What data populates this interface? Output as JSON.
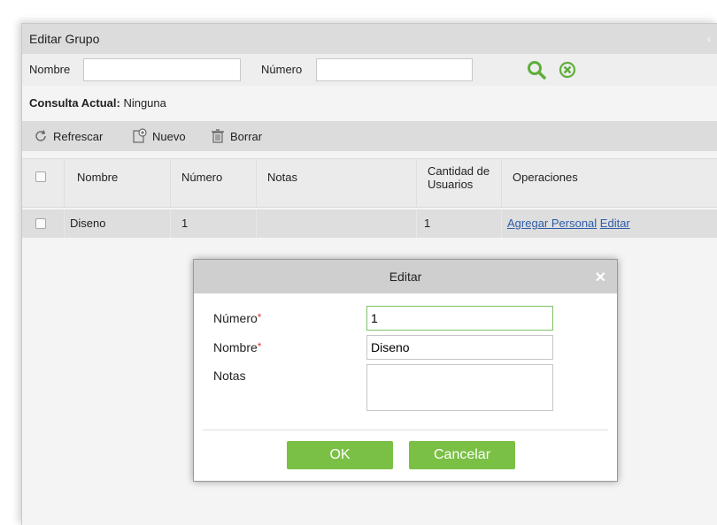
{
  "window": {
    "title": "Editar Grupo",
    "collapse_icon": "chevron-left-icon"
  },
  "search": {
    "nombre_label": "Nombre",
    "nombre_value": "",
    "numero_label": "Número",
    "numero_value": "",
    "search_icon": "search-icon",
    "clear_icon": "clear-circle-icon",
    "accent_color": "#6ab04c"
  },
  "query": {
    "label": "Consulta Actual:",
    "value": "Ninguna"
  },
  "toolbar": {
    "refresh_label": "Refrescar",
    "new_label": "Nuevo",
    "delete_label": "Borrar"
  },
  "table": {
    "headers": [
      "Nombre",
      "Número",
      "Notas",
      "Cantidad de Usuarios",
      "Operaciones"
    ],
    "header_cantidad_1": "Cantidad de",
    "header_cantidad_2": "Usuarios",
    "rows": [
      {
        "nombre": "Diseno",
        "numero": "1",
        "notas": "",
        "cantidad": "1",
        "op_add": "Agregar Personal",
        "op_edit": "Editar"
      }
    ]
  },
  "modal": {
    "title": "Editar",
    "close_icon": "close-icon",
    "numero_label": "Número",
    "numero_value": "1",
    "nombre_label": "Nombre",
    "nombre_value": "Diseno",
    "notas_label": "Notas",
    "notas_value": "",
    "required_mark": "*",
    "ok_label": "OK",
    "cancel_label": "Cancelar",
    "button_color": "#7ac045"
  }
}
